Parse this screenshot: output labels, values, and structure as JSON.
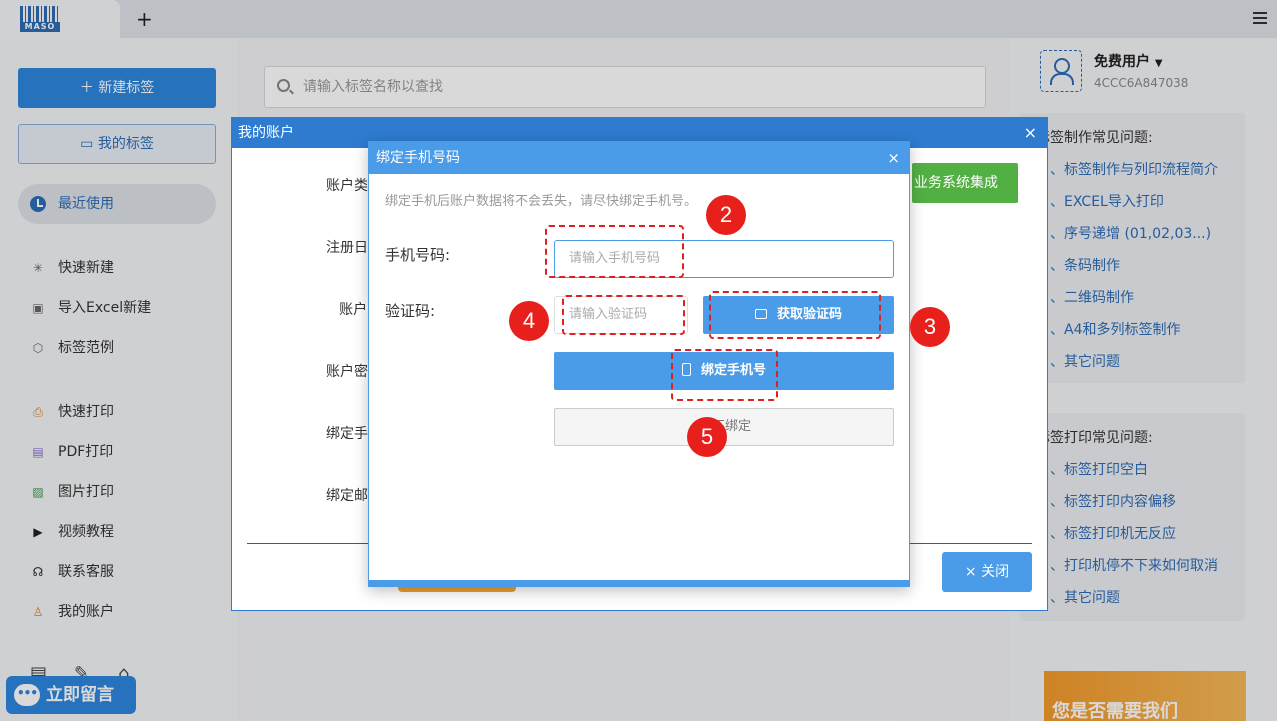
{
  "app": {
    "logo_text": "MASO",
    "add_tab": "+"
  },
  "sidebar": {
    "new_label": "新建标签",
    "my_label": "我的标签",
    "recent_label": "最近使用",
    "items": [
      {
        "label": "快速新建",
        "icon": "sparkle-icon"
      },
      {
        "label": "导入Excel新建",
        "icon": "excel-icon"
      },
      {
        "label": "标签范例",
        "icon": "cube-icon"
      },
      {
        "label": "快速打印",
        "icon": "printer-icon"
      },
      {
        "label": "PDF打印",
        "icon": "pdf-icon"
      },
      {
        "label": "图片打印",
        "icon": "image-icon"
      },
      {
        "label": "视频教程",
        "icon": "video-icon"
      },
      {
        "label": "联系客服",
        "icon": "headset-icon"
      },
      {
        "label": "我的账户",
        "icon": "user-icon"
      }
    ],
    "chat_label": "立即留言"
  },
  "search": {
    "placeholder": "请输入标签名称以查找"
  },
  "user": {
    "name": "免费用户",
    "id": "4CCC6A847038"
  },
  "faq1": {
    "title": "标签制作常见问题:",
    "items": [
      "、标签制作与列印流程简介",
      "、EXCEL导入打印",
      "、序号递增 (01,02,03...)",
      "、条码制作",
      "、二维码制作",
      "、A4和多列标签制作",
      "、其它问题"
    ]
  },
  "faq2": {
    "title": "标签打印常见问题:",
    "items": [
      "、标签打印空白",
      "、标签打印内容偏移",
      "、标签打印机无反应",
      "、打印机停不下来如何取消",
      "、其它问题"
    ]
  },
  "promo": {
    "text": "您是否需要我们"
  },
  "account_dialog": {
    "title": "我的账户",
    "close_x": "×",
    "labels": [
      "账户类型",
      "注册日期",
      "账户ID",
      "账户密码",
      "绑定手机",
      "绑定邮箱"
    ],
    "business_btn": "业务系统集成",
    "close_btn": "关闭"
  },
  "bind_dialog": {
    "title": "绑定手机号码",
    "close_x": "×",
    "hint": "绑定手机后账户数据将不会丢失，请尽快绑定手机号。",
    "phone_label": "手机号码:",
    "phone_placeholder": "请输入手机号码",
    "code_label": "验证码:",
    "code_placeholder": "请输入验证码",
    "get_code_btn": "获取验证码",
    "bind_btn": "绑定手机号",
    "skip_btn": "不绑定"
  },
  "annotations": [
    "2",
    "3",
    "4",
    "5"
  ]
}
